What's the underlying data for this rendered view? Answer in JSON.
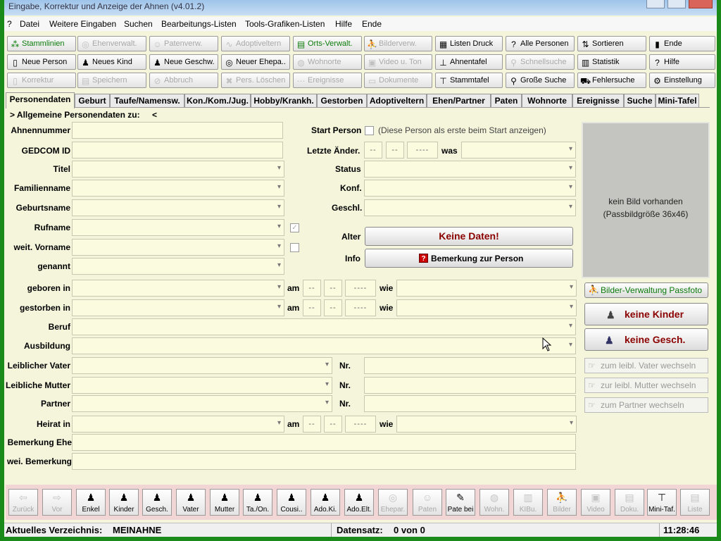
{
  "window": {
    "title": "Eingabe, Korrektur und Anzeige der Ahnen (v4.01.2)"
  },
  "menu": [
    "?",
    "Datei",
    "Weitere Eingaben",
    "Suchen",
    "Bearbeitungs-Listen",
    "Tools-Grafiken-Listen",
    "Hilfe",
    "Ende"
  ],
  "toolbar": {
    "row1": [
      {
        "label": "Stammlinien",
        "icon": "tree-icon",
        "glyph": "⁂",
        "state": "active-green"
      },
      {
        "label": "Ehenverwalt.",
        "icon": "rings-icon",
        "glyph": "◎",
        "state": "disabled"
      },
      {
        "label": "Patenverw.",
        "icon": "face-icon",
        "glyph": "☺",
        "state": "disabled"
      },
      {
        "label": "Adoptiveltern",
        "icon": "parents-icon",
        "glyph": "∿",
        "state": "disabled"
      },
      {
        "label": "Orts-Verwalt.",
        "icon": "printer-icon",
        "glyph": "▤",
        "state": "active-green"
      },
      {
        "label": "Bilderverw.",
        "icon": "walker-icon",
        "glyph": "⛹",
        "state": "disabled"
      },
      {
        "label": "Listen Druck",
        "icon": "list-icon",
        "glyph": "▦",
        "state": "enabled"
      },
      {
        "label": "Alle Personen",
        "icon": "question-people-icon",
        "glyph": "?",
        "state": "enabled"
      },
      {
        "label": "Sortieren",
        "icon": "sort-icon",
        "glyph": "⇅",
        "state": "enabled"
      },
      {
        "label": "Ende",
        "icon": "exit-door-icon",
        "glyph": "▮",
        "state": "enabled"
      }
    ],
    "row2": [
      {
        "label": "Neue Person",
        "icon": "document-icon",
        "glyph": "▯",
        "state": "enabled"
      },
      {
        "label": "Neues Kind",
        "icon": "child-icon",
        "glyph": "♟",
        "state": "enabled"
      },
      {
        "label": "Neue Geschw.",
        "icon": "siblings-icon",
        "glyph": "♟",
        "state": "enabled"
      },
      {
        "label": "Neuer Ehepa..",
        "icon": "couple-rings-icon",
        "glyph": "◎",
        "state": "enabled"
      },
      {
        "label": "Wohnorte",
        "icon": "globe-icon",
        "glyph": "◍",
        "state": "disabled"
      },
      {
        "label": "Video u. Ton",
        "icon": "video-icon",
        "glyph": "▣",
        "state": "disabled"
      },
      {
        "label": "Ahnentafel",
        "icon": "ancestor-tree-icon",
        "glyph": "⊥",
        "state": "enabled"
      },
      {
        "label": "Schnellsuche",
        "icon": "quicksearch-icon",
        "glyph": "⚲",
        "state": "disabled"
      },
      {
        "label": "Statistik",
        "icon": "chart-icon",
        "glyph": "▥",
        "state": "enabled"
      },
      {
        "label": "Hilfe",
        "icon": "help-icon",
        "glyph": "?",
        "state": "enabled"
      }
    ],
    "row3": [
      {
        "label": "Korrektur",
        "icon": "edit-icon",
        "glyph": "▯",
        "state": "disabled"
      },
      {
        "label": "Speichern",
        "icon": "save-icon",
        "glyph": "▤",
        "state": "disabled"
      },
      {
        "label": "Abbruch",
        "icon": "cancel-icon",
        "glyph": "⊘",
        "state": "disabled"
      },
      {
        "label": "Pers. Löschen",
        "icon": "trash-icon",
        "glyph": "✖",
        "state": "disabled"
      },
      {
        "label": "Ereignisse",
        "icon": "events-icon",
        "glyph": "⋯",
        "state": "disabled"
      },
      {
        "label": "Dokumente",
        "icon": "documents-icon",
        "glyph": "▭",
        "state": "disabled"
      },
      {
        "label": "Stammtafel",
        "icon": "family-tree-icon",
        "glyph": "⊤",
        "state": "enabled"
      },
      {
        "label": "Große Suche",
        "icon": "search-icon",
        "glyph": "⚲",
        "state": "enabled"
      },
      {
        "label": "Fehlersuche",
        "icon": "car-icon",
        "glyph": "⛟",
        "state": "enabled"
      },
      {
        "label": "Einstellung",
        "icon": "settings-icon",
        "glyph": "⚙",
        "state": "enabled"
      }
    ]
  },
  "tabs": [
    "Personendaten",
    "Geburt",
    "Taufe/Namensw.",
    "Kon./Kom./Jug.",
    "Hobby/Krankh.",
    "Gestorben",
    "Adoptiveltern",
    "Ehen/Partner",
    "Paten",
    "Wohnorte",
    "Ereignisse",
    "Suche",
    "Mini-Tafel"
  ],
  "form": {
    "header": "> Allgemeine Personendaten zu:",
    "header_value": "<",
    "labels": {
      "ahnennummer": "Ahnennummer",
      "gedcom": "GEDCOM ID",
      "titel": "Titel",
      "familienname": "Familienname",
      "geburtsname": "Geburtsname",
      "rufname": "Rufname",
      "weit_vorname": "weit. Vorname",
      "genannt": "genannt",
      "geboren": "geboren in",
      "gestorben": "gestorben in",
      "beruf": "Beruf",
      "ausbildung": "Ausbildung",
      "vater": "Leiblicher Vater",
      "mutter": "Leibliche Mutter",
      "partner": "Partner",
      "heirat": "Heirat in",
      "bemerkung_ehe": "Bemerkung Ehe",
      "wei_bemerkung": "wei. Bemerkung",
      "start_person": "Start Person",
      "letzte_aender": "Letzte Änder.",
      "status": "Status",
      "konf": "Konf.",
      "geschl": "Geschl.",
      "alter": "Alter",
      "info": "Info",
      "am": "am",
      "wie": "wie",
      "was": "was",
      "nr": "Nr."
    },
    "start_person_note": "(Diese Person als erste beim Start anzeigen)",
    "date_day": "--",
    "date_month": "--",
    "date_year": "----",
    "checkbox_glyph": "✓",
    "alter_button": "Keine Daten!",
    "info_button": "Bemerkung zur Person",
    "info_icon_glyph": "?"
  },
  "photo": {
    "line1": "kein Bild vorhanden",
    "line2": "(Passbildgröße 36x46)",
    "manage_button": "Bilder-Verwaltung Passfoto"
  },
  "side_buttons": {
    "kinder": "keine Kinder",
    "geschwister": "keine Gesch.",
    "vater_wechseln": "zum leibl. Vater wechseln",
    "mutter_wechseln": "zur leibl. Mutter wechseln",
    "partner_wechseln": "zum Partner wechseln"
  },
  "bottom_bar": [
    {
      "label": "Zurück",
      "icon": "back-arrow-icon",
      "glyph": "⇦",
      "state": "disabled"
    },
    {
      "label": "Vor",
      "icon": "forward-arrow-icon",
      "glyph": "⇨",
      "state": "disabled"
    },
    {
      "label": "Enkel",
      "icon": "grandchild-icon",
      "glyph": "♟",
      "state": "enabled"
    },
    {
      "label": "Kinder",
      "icon": "children-icon",
      "glyph": "♟",
      "state": "enabled"
    },
    {
      "label": "Gesch.",
      "icon": "siblings-icon",
      "glyph": "♟",
      "state": "enabled"
    },
    {
      "label": "Vater",
      "icon": "father-icon",
      "glyph": "♟",
      "state": "enabled"
    },
    {
      "label": "Mutter",
      "icon": "mother-icon",
      "glyph": "♟",
      "state": "enabled"
    },
    {
      "label": "Ta./On.",
      "icon": "aunt-uncle-icon",
      "glyph": "♟",
      "state": "enabled"
    },
    {
      "label": "Cousi..",
      "icon": "cousin-icon",
      "glyph": "♟",
      "state": "enabled"
    },
    {
      "label": "Ado.Ki.",
      "icon": "adopted-child-icon",
      "glyph": "♟",
      "state": "enabled"
    },
    {
      "label": "Ado.Elt.",
      "icon": "adoptive-parents-icon",
      "glyph": "♟",
      "state": "enabled"
    },
    {
      "label": "Ehepar.",
      "icon": "rings-icon",
      "glyph": "◎",
      "state": "disabled"
    },
    {
      "label": "Paten",
      "icon": "face-icon",
      "glyph": "☺",
      "state": "disabled"
    },
    {
      "label": "Pate bei",
      "icon": "pate-icon",
      "glyph": "✎",
      "state": "enabled"
    },
    {
      "label": "Wohn.",
      "icon": "globe-icon",
      "glyph": "◍",
      "state": "disabled"
    },
    {
      "label": "KIBu.",
      "icon": "church-book-icon",
      "glyph": "▥",
      "state": "disabled"
    },
    {
      "label": "Bilder",
      "icon": "walker-icon",
      "glyph": "⛹",
      "state": "disabled"
    },
    {
      "label": "Video",
      "icon": "video-icon",
      "glyph": "▣",
      "state": "disabled"
    },
    {
      "label": "Doku.",
      "icon": "document-icon",
      "glyph": "▤",
      "state": "disabled"
    },
    {
      "label": "Mini-Taf.",
      "icon": "mini-tree-icon",
      "glyph": "⊤",
      "state": "enabled"
    },
    {
      "label": "Liste",
      "icon": "list-icon",
      "glyph": "▤",
      "state": "disabled"
    }
  ],
  "status": {
    "verzeichnis_label": "Aktuelles Verzeichnis:",
    "verzeichnis_value": "MEINAHNE",
    "datensatz_label": "Datensatz:",
    "datensatz_value": "0 von 0",
    "time": "11:28:46"
  },
  "colors": {
    "background": "#f5f5dc",
    "field": "#fbfbe0",
    "red_text": "#8b0000",
    "green_text": "#0a7a0a",
    "photo_bg": "#c4c4c0",
    "bottom_bar": "#f2d5d5",
    "border": "#1a8a1a"
  }
}
